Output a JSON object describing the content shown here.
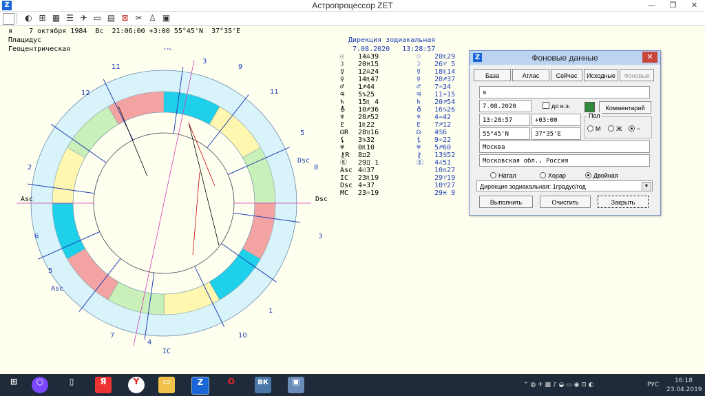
{
  "window": {
    "title": "Астропроцессор ZET",
    "min": "—",
    "max": "❐",
    "close": "✕"
  },
  "chart_info": {
    "line1": "я    7 октября 1984  Вс  21:06:00 +3:00 55°45'N  37°35'E",
    "line2": "Плацидус",
    "line3": "Геоцентрическая"
  },
  "direction": {
    "title": "Дирекция зодиакальная",
    "date": "7.08.2020   13:28:57"
  },
  "natal_positions": [
    {
      "sym": "☉",
      "val": "14♎39"
    },
    {
      "sym": "☽",
      "val": "20♓15"
    },
    {
      "sym": "☿",
      "val": "12♎24"
    },
    {
      "sym": "♀",
      "val": "14♏47"
    },
    {
      "sym": "♂",
      "val": "1♐44"
    },
    {
      "sym": "♃",
      "val": "5♑25"
    },
    {
      "sym": "♄",
      "val": "15♏ 4"
    },
    {
      "sym": "⛢",
      "val": "10♐36"
    },
    {
      "sym": "♆",
      "val": "28♐52"
    },
    {
      "sym": "♇",
      "val": "1♏22"
    },
    {
      "sym": "☊R",
      "val": "28♉16"
    },
    {
      "sym": "⚸",
      "val": "3♑32"
    },
    {
      "sym": "♅",
      "val": "0♏10"
    },
    {
      "sym": "⚷R",
      "val": "8♊2"
    },
    {
      "sym": "Ⓔ",
      "val": "29♊ 1"
    },
    {
      "sym": "Asc",
      "val": "4♌37"
    },
    {
      "sym": "IC",
      "val": "23♏19"
    },
    {
      "sym": "Dsc",
      "val": "4♒37"
    },
    {
      "sym": "MC",
      "val": "23♒19"
    }
  ],
  "directed_positions": [
    {
      "sym": "☉",
      "val": "20♏29"
    },
    {
      "sym": "☽",
      "val": "26♈ 5"
    },
    {
      "sym": "☿",
      "val": "18♏14"
    },
    {
      "sym": "♀",
      "val": "20♐37"
    },
    {
      "sym": "♂",
      "val": "7♒34"
    },
    {
      "sym": "♃",
      "val": "11♒15"
    },
    {
      "sym": "♄",
      "val": "20♐54"
    },
    {
      "sym": "⛢",
      "val": "16♑26"
    },
    {
      "sym": "♆",
      "val": "4♒42"
    },
    {
      "sym": "♇",
      "val": "7♐12"
    },
    {
      "sym": "☊",
      "val": "4♋6"
    },
    {
      "sym": "⚸",
      "val": "9♒22"
    },
    {
      "sym": "♅",
      "val": "5♐60"
    },
    {
      "sym": "⚷",
      "val": "13♋52"
    },
    {
      "sym": "Ⓔ",
      "val": "4♌51"
    },
    {
      "sym": "",
      "val": "10♎27"
    },
    {
      "sym": "",
      "val": "29♈19"
    },
    {
      "sym": "",
      "val": "10♈27"
    },
    {
      "sym": "",
      "val": "29♓ 9"
    }
  ],
  "wheel": {
    "angles": {
      "mc": "MC",
      "ic": "IC",
      "asc": "Asc",
      "dsc": "Dsc",
      "asc2": "Asc",
      "dsc2": "Dsc",
      "mc2": "MC",
      "ic2": "IC"
    },
    "houses": [
      "11",
      "9",
      "12",
      "8",
      "2",
      "6",
      "3",
      "5",
      "1",
      "7",
      "4",
      "10",
      "3",
      "5",
      "11",
      "9",
      "12",
      "2",
      "6",
      "8"
    ]
  },
  "dialog": {
    "title": "Фоновые данные",
    "tabs": [
      "База",
      "Атлас",
      "Сейчас",
      "Исходные",
      "Фоновые"
    ],
    "name": "я",
    "date": "7.08.2020",
    "bc_label": "до н.э.",
    "comment_btn": "Комментарий",
    "time": "13:28:57",
    "tz": "+03:00",
    "gender_label": "Пол",
    "gender_m": "М",
    "gender_f": "Ж",
    "gender_none": "−",
    "lat": "55°45'N",
    "lon": "37°35'E",
    "city": "Москва",
    "region": "Московская обл., Россия",
    "mode_natal": "Натал",
    "mode_horar": "Хорар",
    "mode_double": "Двойная",
    "method": "Дирекция зодиакальная: 1градус/год",
    "run_btn": "Выполнить",
    "clear_btn": "Очистить",
    "close_btn": "Закрыть"
  },
  "taskbar": {
    "lang": "РУС",
    "time": "16:18",
    "date": "23.04.2019"
  },
  "colors": {
    "fire": "#f4a3a3",
    "earth": "#c9f0b8",
    "air": "#fff6b0",
    "water": "#1fd0ea",
    "outer": "#d9f3fb",
    "blue": "#1d3fb5"
  }
}
